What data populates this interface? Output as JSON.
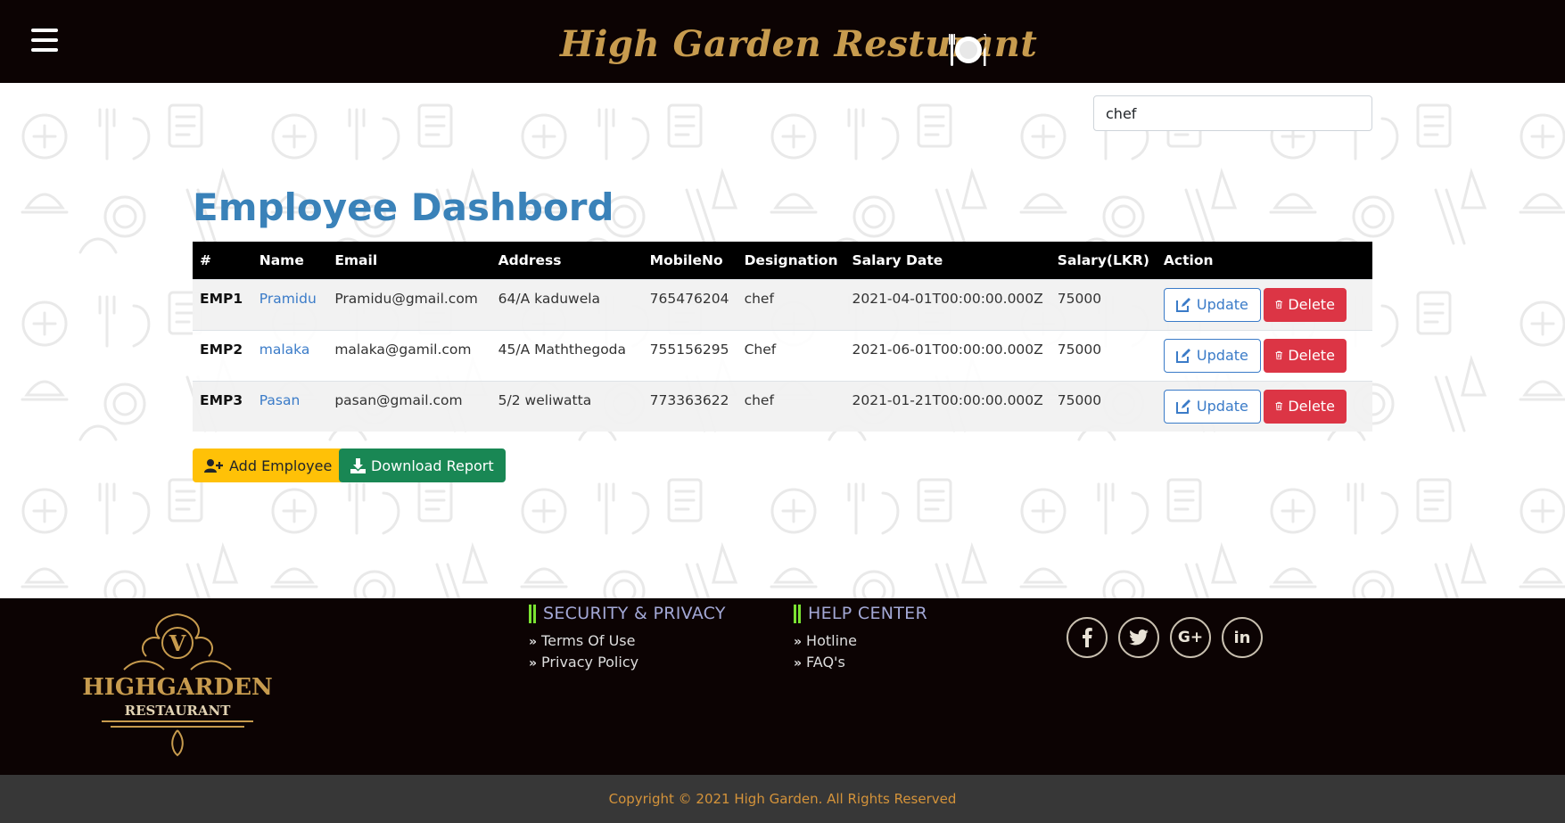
{
  "header": {
    "brand_title": "High Garden Resturant",
    "brand_icon": "plate-cutlery-icon",
    "menu_icon": "hamburger-menu-icon"
  },
  "search": {
    "value": "chef"
  },
  "page_title": "Employee Dashbord",
  "table": {
    "headers": [
      "#",
      "Name",
      "Email",
      "Address",
      "MobileNo",
      "Designation",
      "Salary Date",
      "Salary(LKR)",
      "Action"
    ],
    "rows": [
      {
        "id": "EMP1",
        "name": "Pramidu",
        "email": "Pramidu@gmail.com",
        "address": "64/A kaduwela",
        "mobile": "765476204",
        "designation": "chef",
        "salary_date": "2021-04-01T00:00:00.000Z",
        "salary": "75000"
      },
      {
        "id": "EMP2",
        "name": "malaka",
        "email": "malaka@gamil.com",
        "address": "45/A Maththegoda",
        "mobile": "755156295",
        "designation": "Chef",
        "salary_date": "2021-06-01T00:00:00.000Z",
        "salary": "75000"
      },
      {
        "id": "EMP3",
        "name": "Pasan",
        "email": "pasan@gmail.com",
        "address": "5/2 weliwatta",
        "mobile": "773363622",
        "designation": "chef",
        "salary_date": "2021-01-21T00:00:00.000Z",
        "salary": "75000"
      }
    ],
    "update_label": "Update",
    "delete_label": "Delete"
  },
  "actions": {
    "add_label": "Add Employee",
    "download_label": "Download Report"
  },
  "footer": {
    "logo": {
      "letter": "V",
      "name": "HIGHGARDEN",
      "subtitle": "RESTAURANT"
    },
    "security": {
      "heading": "SECURITY & PRIVACY",
      "links": [
        "Terms Of Use",
        "Privacy Policy"
      ]
    },
    "help": {
      "heading": "HELP CENTER",
      "links": [
        "Hotline",
        "FAQ's"
      ]
    },
    "social": [
      "facebook-icon",
      "twitter-icon",
      "google-plus-icon",
      "linkedin-icon"
    ],
    "copyright": "Copyright © 2021 High Garden. All Rights Reserved"
  },
  "colors": {
    "header_bg": "#0c0303",
    "brand_gold": "#c79b4e",
    "title_blue": "#3a82b9",
    "update_blue": "#3a7bc8",
    "delete_red": "#dc3545",
    "add_yellow": "#ffc107",
    "download_green": "#198754",
    "copyright_bar": "#373737"
  }
}
